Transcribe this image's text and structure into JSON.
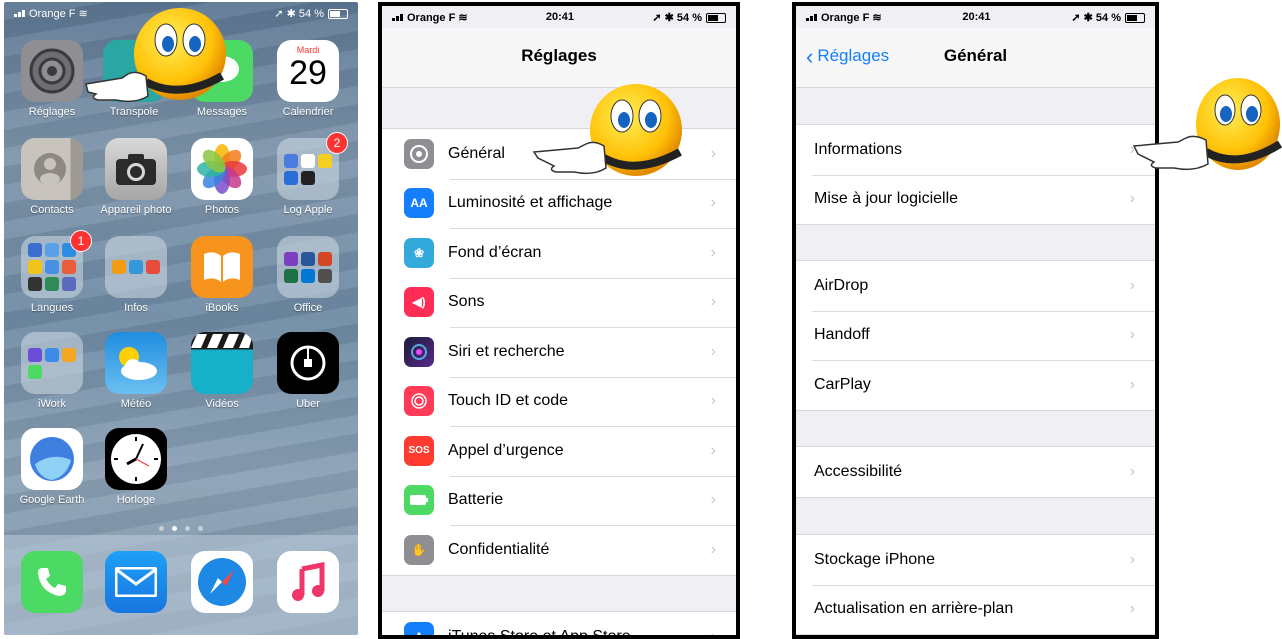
{
  "home": {
    "status": {
      "carrier": "Orange F",
      "battery": "54 %"
    },
    "calendar": {
      "day": "Mardi",
      "date": "29"
    },
    "apps": [
      {
        "label": "Réglages"
      },
      {
        "label": "Transpole"
      },
      {
        "label": "Messages"
      },
      {
        "label": "Calendrier"
      },
      {
        "label": "Contacts"
      },
      {
        "label": "Appareil photo"
      },
      {
        "label": "Photos"
      },
      {
        "label": "Log Apple",
        "badge": "2"
      },
      {
        "label": "Langues",
        "badge": "1"
      },
      {
        "label": "Infos"
      },
      {
        "label": "iBooks"
      },
      {
        "label": "Office"
      },
      {
        "label": "iWork"
      },
      {
        "label": "Météo"
      },
      {
        "label": "Vidéos"
      },
      {
        "label": "Uber"
      },
      {
        "label": "Google Earth"
      },
      {
        "label": "Horloge"
      }
    ],
    "dock": [
      "phone",
      "mail",
      "safari",
      "music"
    ]
  },
  "settings": {
    "status": {
      "carrier": "Orange F",
      "time": "20:41",
      "battery": "54 %"
    },
    "title": "Réglages",
    "items": [
      {
        "label": "Général",
        "icon": "gear-icon",
        "color": "#8e8e93"
      },
      {
        "label": "Luminosité et affichage",
        "icon": "text-size-icon",
        "color": "#157efb"
      },
      {
        "label": "Fond d’écran",
        "icon": "wallpaper-icon",
        "color": "#34aadc"
      },
      {
        "label": "Sons",
        "icon": "speaker-icon",
        "color": "#ff2d55"
      },
      {
        "label": "Siri et recherche",
        "icon": "siri-icon",
        "color": "#222244"
      },
      {
        "label": "Touch ID et code",
        "icon": "fingerprint-icon",
        "color": "#ff3b58"
      },
      {
        "label": "Appel d’urgence",
        "icon": "sos-icon",
        "color": "#ff3b30",
        "glyph": "SOS"
      },
      {
        "label": "Batterie",
        "icon": "battery-icon",
        "color": "#4cd964"
      },
      {
        "label": "Confidentialité",
        "icon": "hand-icon",
        "color": "#8e8e93"
      }
    ],
    "last_item": {
      "label": "iTunes Store et App Store",
      "icon": "app-store-icon",
      "color": "#157efb"
    }
  },
  "general": {
    "status": {
      "carrier": "Orange F",
      "time": "20:41",
      "battery": "54 %"
    },
    "back_label": "Réglages",
    "title": "Général",
    "groups": [
      [
        "Informations",
        "Mise à jour logicielle"
      ],
      [
        "AirDrop",
        "Handoff",
        "CarPlay"
      ],
      [
        "Accessibilité"
      ],
      [
        "Stockage iPhone",
        "Actualisation en arrière-plan"
      ]
    ]
  }
}
